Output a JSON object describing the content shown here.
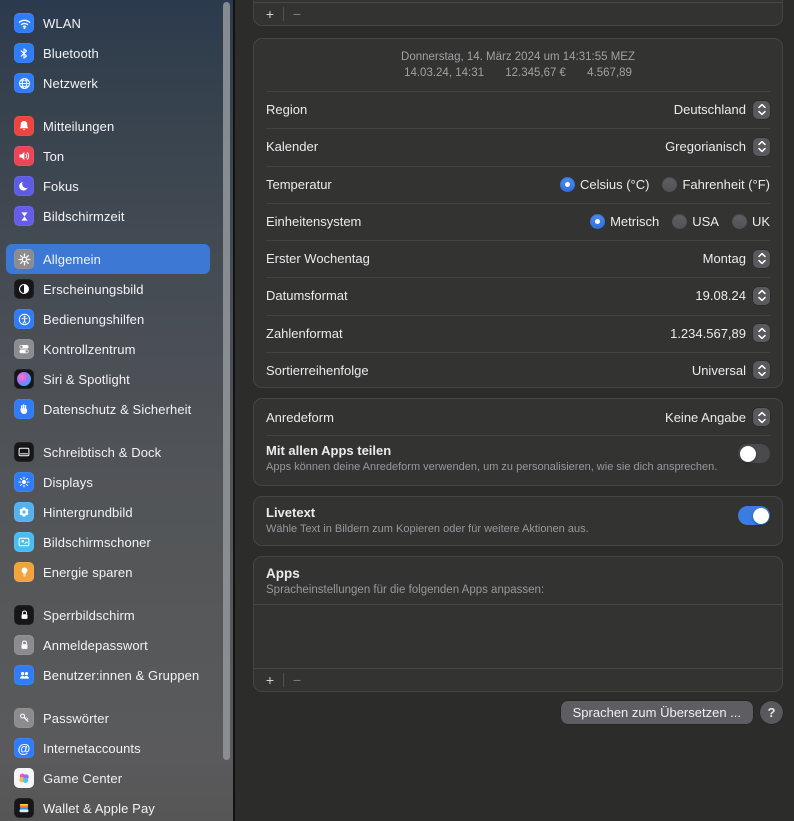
{
  "sidebar": {
    "groups": [
      {
        "items": [
          {
            "label": "WLAN",
            "icon": "wifi",
            "icon_color": "#2f7cf6"
          },
          {
            "label": "Bluetooth",
            "icon": "bluetooth",
            "icon_color": "#2f7cf6"
          },
          {
            "label": "Netzwerk",
            "icon": "globe",
            "icon_color": "#2f7cf6"
          }
        ]
      },
      {
        "items": [
          {
            "label": "Mitteilungen",
            "icon": "bell",
            "icon_color": "#ec4540"
          },
          {
            "label": "Ton",
            "icon": "speaker",
            "icon_color": "#ec4558"
          },
          {
            "label": "Fokus",
            "icon": "moon",
            "icon_color": "#5d5ce2"
          },
          {
            "label": "Bildschirmzeit",
            "icon": "hourglass",
            "icon_color": "#655de8"
          }
        ]
      },
      {
        "items": [
          {
            "label": "Allgemein",
            "icon": "gear",
            "icon_color": "#8b8b90",
            "selected": true
          },
          {
            "label": "Erscheinungsbild",
            "icon": "contrast",
            "icon_color": "#161618"
          },
          {
            "label": "Bedienungshilfen",
            "icon": "accessibility",
            "icon_color": "#2f7cf6"
          },
          {
            "label": "Kontrollzentrum",
            "icon": "toggles",
            "icon_color": "#8b8b90"
          },
          {
            "label": "Siri & Spotlight",
            "icon": "siri",
            "icon_color": "#161618"
          },
          {
            "label": "Datenschutz & Sicherheit",
            "icon": "hand",
            "icon_color": "#2f7cf6"
          }
        ]
      },
      {
        "items": [
          {
            "label": "Schreibtisch & Dock",
            "icon": "dock",
            "icon_color": "#161618"
          },
          {
            "label": "Displays",
            "icon": "sun",
            "icon_color": "#2f7cf6"
          },
          {
            "label": "Hintergrundbild",
            "icon": "flower",
            "icon_color": "#53b1ee"
          },
          {
            "label": "Bildschirmschoner",
            "icon": "screensaver",
            "icon_color": "#49bdf3"
          },
          {
            "label": "Energie sparen",
            "icon": "bulb",
            "icon_color": "#f1a33c"
          }
        ]
      },
      {
        "items": [
          {
            "label": "Sperrbildschirm",
            "icon": "lock",
            "icon_color": "#161618"
          },
          {
            "label": "Anmeldepasswort",
            "icon": "lock",
            "icon_color": "#8b8b90"
          },
          {
            "label": "Benutzer:innen & Gruppen",
            "icon": "users",
            "icon_color": "#2f7cf6"
          }
        ]
      },
      {
        "items": [
          {
            "label": "Passwörter",
            "icon": "key",
            "icon_color": "#8b8b90"
          },
          {
            "label": "Internetaccounts",
            "icon": "at",
            "icon_color": "#2f7cf6"
          },
          {
            "label": "Game Center",
            "icon": "gamecenter",
            "icon_color": "#f5f5f7"
          },
          {
            "label": "Wallet & Apple Pay",
            "icon": "wallet",
            "icon_color": "#161618"
          }
        ]
      }
    ]
  },
  "main": {
    "languages_footer": {
      "add_label": "+",
      "remove_label": "−"
    },
    "preview": {
      "line1": "Donnerstag, 14. März 2024 um 14:31:55 MEZ",
      "date_time": "14.03.24, 14:31",
      "currency": "12.345,67 €",
      "number": "4.567,89"
    },
    "rows": {
      "region": {
        "label": "Region",
        "value": "Deutschland"
      },
      "calendar": {
        "label": "Kalender",
        "value": "Gregorianisch"
      },
      "temperature": {
        "label": "Temperatur",
        "options": [
          {
            "label": "Celsius (°C)",
            "selected": true
          },
          {
            "label": "Fahrenheit (°F)",
            "selected": false
          }
        ]
      },
      "units": {
        "label": "Einheitensystem",
        "options": [
          {
            "label": "Metrisch",
            "selected": true
          },
          {
            "label": "USA",
            "selected": false
          },
          {
            "label": "UK",
            "selected": false
          }
        ]
      },
      "first_weekday": {
        "label": "Erster Wochentag",
        "value": "Montag"
      },
      "date_format": {
        "label": "Datumsformat",
        "value": "19.08.24"
      },
      "number_format": {
        "label": "Zahlenformat",
        "value": "1.234.567,89"
      },
      "sort_order": {
        "label": "Sortierreihenfolge",
        "value": "Universal"
      }
    },
    "form_of_address": {
      "label": "Anredeform",
      "value": "Keine Angabe"
    },
    "share_with_apps": {
      "title": "Mit allen Apps teilen",
      "subtitle": "Apps können deine Anredeform verwenden, um zu personalisieren, wie sie dich ansprechen.",
      "enabled": false
    },
    "live_text": {
      "title": "Livetext",
      "subtitle": "Wähle Text in Bildern zum Kopieren oder für weitere Aktionen aus.",
      "enabled": true
    },
    "apps_section": {
      "title": "Apps",
      "subtitle": "Spracheinstellungen für die folgenden Apps anpassen:",
      "add_label": "+",
      "remove_label": "−"
    },
    "footer": {
      "translate_button": "Sprachen zum Übersetzen ...",
      "help_label": "?"
    }
  },
  "colors": {
    "accent": "#3b7ce2",
    "selection": "#3d78d5"
  }
}
